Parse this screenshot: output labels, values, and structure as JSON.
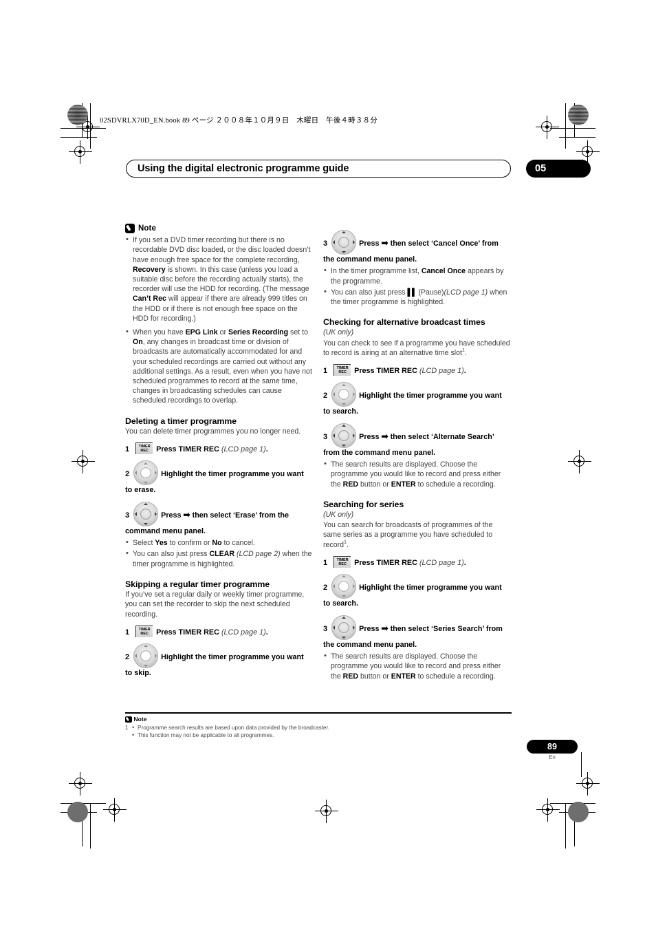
{
  "print_banner": "02SDVRLX70D_EN.book  89 ページ  ２００８年１０月９日　木曜日　午後４時３８分",
  "header": {
    "chapter_title": "Using the digital electronic programme guide",
    "chapter_number": "05"
  },
  "colors": {
    "badge_bg": "#000000",
    "badge_text": "#ffffff",
    "body_text": "#3e3e3e",
    "emphasis_text": "#000000"
  },
  "icons": {
    "note": "pencil-note-icon",
    "timer_rec": "timer-rec-button-icon",
    "dpad": "dpad-cursor-icon",
    "arrow_right": "➡",
    "pause": "▌▌"
  },
  "left_column": {
    "note": {
      "label": "Note",
      "bullets": [
        {
          "runs": [
            {
              "t": "If you set a DVD timer recording but there is no recordable DVD disc loaded, or the disc loaded doesn’t have enough free space for the complete recording, "
            },
            {
              "t": "Recovery",
              "s": "b"
            },
            {
              "t": " is shown. In this case (unless you load a suitable disc before the recording actually starts), the recorder will use the HDD for recording. (The message "
            },
            {
              "t": "Can’t Rec",
              "s": "b"
            },
            {
              "t": " will appear if there are already 999 titles on the HDD or if there is not enough free space on the HDD for recording.)"
            }
          ]
        },
        {
          "runs": [
            {
              "t": "When you have "
            },
            {
              "t": "EPG Link",
              "s": "b"
            },
            {
              "t": " or "
            },
            {
              "t": "Series Recording",
              "s": "b"
            },
            {
              "t": " set to "
            },
            {
              "t": "On",
              "s": "b"
            },
            {
              "t": ", any changes in broadcast time or division of broadcasts are automatically accommodated for and your scheduled recordings are carried out without any additional settings. As a result, even when you have not scheduled programmes to record at the same time, changes in broadcasting schedules can cause scheduled recordings to overlap."
            }
          ]
        }
      ]
    },
    "sections": [
      {
        "heading": "Deleting a timer programme",
        "subheading": "",
        "intro": "You can delete timer programmes you no longer need.",
        "steps": [
          {
            "num": "1",
            "icon": "timer",
            "runs": [
              {
                "t": "Press TIMER REC ",
                "s": "b"
              },
              {
                "t": "(LCD page 1)",
                "s": "it"
              },
              {
                "t": ".",
                "s": "b"
              }
            ],
            "sub": []
          },
          {
            "num": "2",
            "icon": "dpad",
            "runs": [
              {
                "t": "Highlight the timer programme you want to erase.",
                "s": "b"
              }
            ],
            "sub": []
          },
          {
            "num": "3",
            "icon": "dpad-filled",
            "runs": [
              {
                "t": "Press ",
                "s": "b"
              },
              {
                "t": "➡",
                "s": "arrow"
              },
              {
                "t": " then select ‘Erase’ from the command menu panel.",
                "s": "b"
              }
            ],
            "sub": [
              {
                "runs": [
                  {
                    "t": "Select "
                  },
                  {
                    "t": "Yes",
                    "s": "b"
                  },
                  {
                    "t": " to confirm or "
                  },
                  {
                    "t": "No",
                    "s": "b"
                  },
                  {
                    "t": " to cancel."
                  }
                ]
              },
              {
                "runs": [
                  {
                    "t": "You can also just press "
                  },
                  {
                    "t": "CLEAR",
                    "s": "b"
                  },
                  {
                    "t": " "
                  },
                  {
                    "t": "(LCD page 2)",
                    "s": "it"
                  },
                  {
                    "t": " when the timer programme is highlighted."
                  }
                ]
              }
            ]
          }
        ]
      },
      {
        "heading": "Skipping a regular timer programme",
        "subheading": "",
        "intro": "If you’ve set a regular daily or weekly timer programme, you can set the recorder to skip the next scheduled recording.",
        "steps": [
          {
            "num": "1",
            "icon": "timer",
            "runs": [
              {
                "t": "Press TIMER REC ",
                "s": "b"
              },
              {
                "t": "(LCD page 1)",
                "s": "it"
              },
              {
                "t": ".",
                "s": "b"
              }
            ],
            "sub": []
          },
          {
            "num": "2",
            "icon": "dpad",
            "runs": [
              {
                "t": "Highlight the timer programme you want to skip.",
                "s": "b"
              }
            ],
            "sub": []
          }
        ]
      }
    ]
  },
  "right_column": {
    "continued_step": {
      "num": "3",
      "icon": "dpad-filled",
      "runs": [
        {
          "t": "Press ",
          "s": "b"
        },
        {
          "t": "➡",
          "s": "arrow"
        },
        {
          "t": " then select ‘Cancel Once’ from the command menu panel.",
          "s": "b"
        }
      ],
      "sub": [
        {
          "runs": [
            {
              "t": "In the timer programme list, "
            },
            {
              "t": "Cancel Once",
              "s": "b"
            },
            {
              "t": " appears by the programme."
            }
          ]
        },
        {
          "runs": [
            {
              "t": "You can also just press "
            },
            {
              "t": "▌▌",
              "s": "pause"
            },
            {
              "t": " (Pause)"
            },
            {
              "t": "(LCD page 1)",
              "s": "it"
            },
            {
              "t": " when the timer programme is highlighted."
            }
          ]
        }
      ]
    },
    "sections": [
      {
        "heading": "Checking for alternative broadcast times",
        "subheading": "(UK only)",
        "intro_runs": [
          {
            "t": "You can check to see if a programme you have scheduled to record is airing at an alternative time slot"
          },
          {
            "t": "1",
            "s": "sup"
          },
          {
            "t": "."
          }
        ],
        "steps": [
          {
            "num": "1",
            "icon": "timer",
            "runs": [
              {
                "t": "Press TIMER REC ",
                "s": "b"
              },
              {
                "t": "(LCD page 1)",
                "s": "it"
              },
              {
                "t": ".",
                "s": "b"
              }
            ],
            "sub": []
          },
          {
            "num": "2",
            "icon": "dpad",
            "runs": [
              {
                "t": "Highlight the timer programme you want to search.",
                "s": "b"
              }
            ],
            "sub": []
          },
          {
            "num": "3",
            "icon": "dpad-filled",
            "runs": [
              {
                "t": "Press ",
                "s": "b"
              },
              {
                "t": "➡",
                "s": "arrow"
              },
              {
                "t": " then select ‘Alternate Search’ from the command menu panel.",
                "s": "b"
              }
            ],
            "sub": [
              {
                "runs": [
                  {
                    "t": "The search results are displayed. Choose the programme you would like to record and press either the "
                  },
                  {
                    "t": "RED",
                    "s": "b"
                  },
                  {
                    "t": " button or "
                  },
                  {
                    "t": "ENTER",
                    "s": "b"
                  },
                  {
                    "t": " to schedule a recording."
                  }
                ]
              }
            ]
          }
        ]
      },
      {
        "heading": "Searching for series",
        "subheading": "(UK only)",
        "intro_runs": [
          {
            "t": "You can search for broadcasts of programmes of the same series as a programme you have scheduled to record"
          },
          {
            "t": "1",
            "s": "sup"
          },
          {
            "t": "."
          }
        ],
        "steps": [
          {
            "num": "1",
            "icon": "timer",
            "runs": [
              {
                "t": "Press TIMER REC ",
                "s": "b"
              },
              {
                "t": "(LCD page 1)",
                "s": "it"
              },
              {
                "t": ".",
                "s": "b"
              }
            ],
            "sub": []
          },
          {
            "num": "2",
            "icon": "dpad",
            "runs": [
              {
                "t": "Highlight the timer programme you want to search.",
                "s": "b"
              }
            ],
            "sub": []
          },
          {
            "num": "3",
            "icon": "dpad-filled",
            "runs": [
              {
                "t": "Press ",
                "s": "b"
              },
              {
                "t": "➡",
                "s": "arrow"
              },
              {
                "t": " then select ‘Series Search’ from the command menu panel.",
                "s": "b"
              }
            ],
            "sub": [
              {
                "runs": [
                  {
                    "t": "The search results are displayed. Choose the programme you would like to record and press either the "
                  },
                  {
                    "t": "RED",
                    "s": "b"
                  },
                  {
                    "t": " button or "
                  },
                  {
                    "t": "ENTER",
                    "s": "b"
                  },
                  {
                    "t": " to schedule a recording."
                  }
                ]
              }
            ]
          }
        ]
      }
    ]
  },
  "footnote": {
    "label": "Note",
    "marker": "1",
    "items": [
      "Programme search results are based upon data provided by the broadcaster.",
      "This function may not be applicable to all programmes."
    ]
  },
  "footer": {
    "page_number": "89",
    "language_code": "En"
  }
}
